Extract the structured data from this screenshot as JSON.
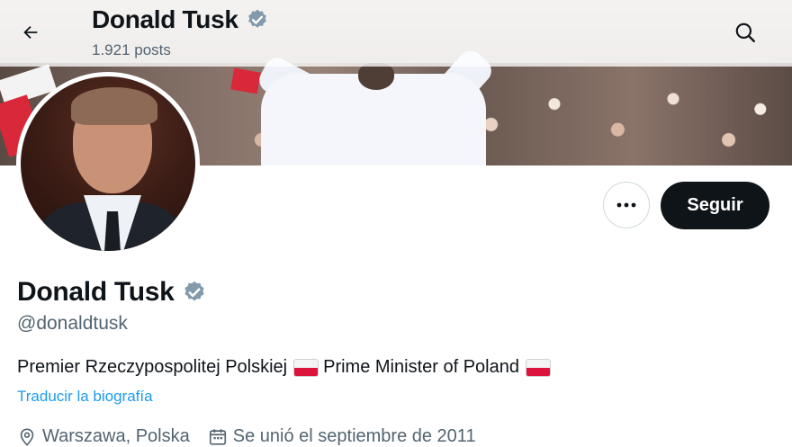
{
  "header": {
    "name": "Donald Tusk",
    "posts": "1.921 posts"
  },
  "profile": {
    "name": "Donald Tusk",
    "handle": "@donaldtusk",
    "bio_part1": "Premier Rzeczypospolitej Polskiej",
    "bio_part2": "Prime Minister of Poland",
    "translate_link": "Traducir la biografía",
    "location": "Warszawa, Polska",
    "joined": "Se unió el septiembre de 2011"
  },
  "actions": {
    "follow_label": "Seguir",
    "more_label": "•••"
  },
  "icons": {
    "back": "back-arrow-icon",
    "search": "search-icon",
    "verified": "verified-badge-icon",
    "location": "location-pin-icon",
    "calendar": "calendar-icon"
  },
  "colors": {
    "accent": "#1d9bf0",
    "verified": "#829aab",
    "text": "#0f1419",
    "secondary": "#536471",
    "follow_bg": "#0f1419"
  }
}
